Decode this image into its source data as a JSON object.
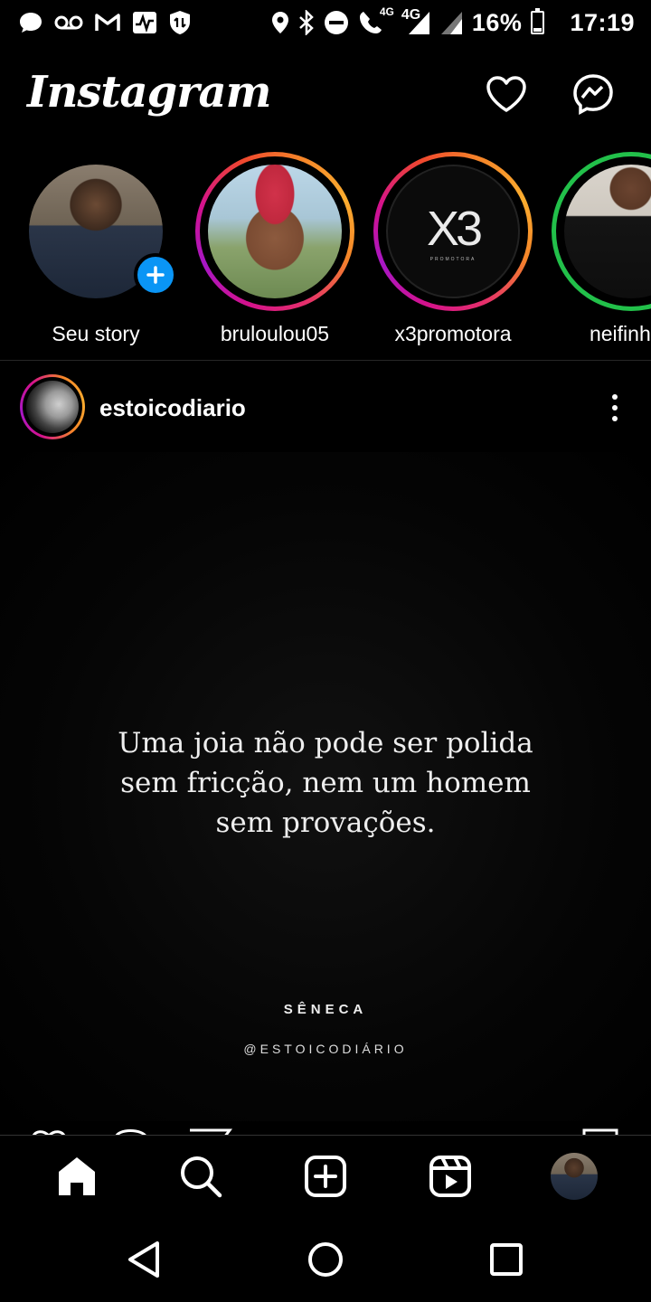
{
  "status_bar": {
    "network_label": "4G",
    "call_network_label": "4G",
    "battery_percent": "16%",
    "battery_level": 0.16,
    "time": "17:19",
    "icons": [
      "chat-icon",
      "voicemail-icon",
      "gmail-icon",
      "activity-icon",
      "vpn-shield-icon",
      "location-icon",
      "bluetooth-icon",
      "do-not-disturb-icon",
      "wifi-call-icon",
      "signal-icon",
      "signal-icon",
      "battery-icon"
    ]
  },
  "header": {
    "logo_text": "Instagram",
    "icons": [
      "heart-icon",
      "messenger-icon"
    ]
  },
  "stories": [
    {
      "label": "Seu story",
      "ring": "none",
      "own": true
    },
    {
      "label": "bruloulou05",
      "ring": "gradient"
    },
    {
      "label": "x3promotora",
      "ring": "gradient",
      "logo_text": "X3",
      "logo_sub": "PROMOTORA"
    },
    {
      "label": "neifinhos",
      "ring": "close-friends"
    }
  ],
  "post": {
    "username": "estoicodiario",
    "quote": "Uma joia não pode ser polida sem fricção, nem um homem sem provações.",
    "author": "SÊNECA",
    "handle": "@ESTOICODIÁRIO"
  },
  "bottom_nav": {
    "items": [
      "home-icon",
      "search-icon",
      "create-post-icon",
      "reels-icon",
      "profile-avatar"
    ]
  },
  "colors": {
    "background": "#000000",
    "add_badge": "#0a95f5",
    "close_friends_ring": "#22c04a"
  }
}
